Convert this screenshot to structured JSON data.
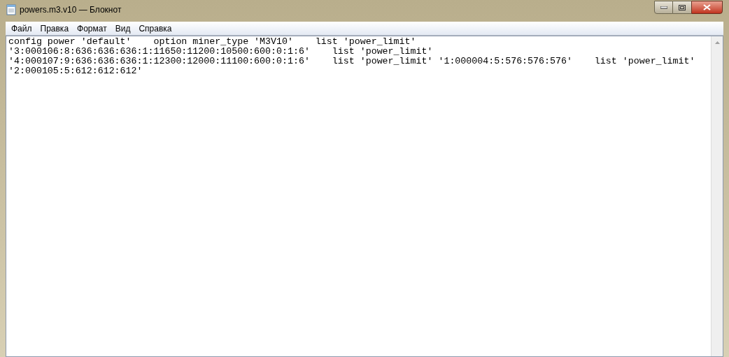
{
  "window": {
    "title": "powers.m3.v10 — Блокнот"
  },
  "menu": [
    "Файл",
    "Правка",
    "Формат",
    "Вид",
    "Справка"
  ],
  "editor": {
    "lines": [
      "config power 'default'    option miner_type 'M3V10'    list 'power_limit'",
      "'3:000106:8:636:636:636:1:11650:11200:10500:600:0:1:6'    list 'power_limit'",
      "'4:000107:9:636:636:636:1:12300:12000:11100:600:0:1:6'    list 'power_limit' '1:000004:5:576:576:576'    list 'power_limit'",
      "'2:000105:5:612:612:612'"
    ]
  }
}
